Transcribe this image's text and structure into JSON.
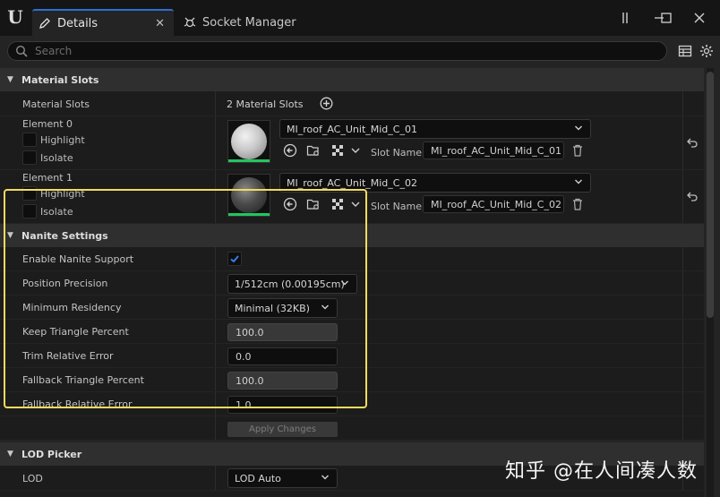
{
  "tabs": [
    {
      "label": "Details",
      "close": "✕"
    },
    {
      "label": "Socket Manager"
    }
  ],
  "search": {
    "placeholder": "Search"
  },
  "material_slots": {
    "header": "Material Slots",
    "row_label": "Material Slots",
    "count_text": "2 Material Slots",
    "elements": [
      {
        "label": "Element 0",
        "highlight": "Highlight",
        "isolate": "Isolate",
        "material": "MI_roof_AC_Unit_Mid_C_01",
        "slot_name_label": "Slot Name",
        "slot_name": "MI_roof_AC_Unit_Mid_C_01"
      },
      {
        "label": "Element 1",
        "highlight": "Highlight",
        "isolate": "Isolate",
        "material": "MI_roof_AC_Unit_Mid_C_02",
        "slot_name_label": "Slot Name",
        "slot_name": "MI_roof_AC_Unit_Mid_C_02"
      }
    ]
  },
  "nanite": {
    "header": "Nanite Settings",
    "enable_label": "Enable Nanite Support",
    "enable_checked": true,
    "position_precision_label": "Position Precision",
    "position_precision_value": "1/512cm (0.00195cm)",
    "minimum_residency_label": "Minimum Residency",
    "minimum_residency_value": "Minimal (32KB)",
    "keep_triangle_label": "Keep Triangle Percent",
    "keep_triangle_value": "100.0",
    "trim_error_label": "Trim Relative Error",
    "trim_error_value": "0.0",
    "fallback_triangle_label": "Fallback Triangle Percent",
    "fallback_triangle_value": "100.0",
    "fallback_error_label": "Fallback Relative Error",
    "fallback_error_value": "1.0",
    "apply_label": "Apply Changes"
  },
  "lod_picker": {
    "header": "LOD Picker",
    "lod_label": "LOD",
    "lod_value": "LOD Auto"
  },
  "watermark": "知乎 @在人间凑人数",
  "colors": {
    "highlight_box": "#f2dc5d",
    "accent": "#2a6fd6",
    "green": "#22c55e",
    "checkbox_blue": "#3b82f6"
  }
}
